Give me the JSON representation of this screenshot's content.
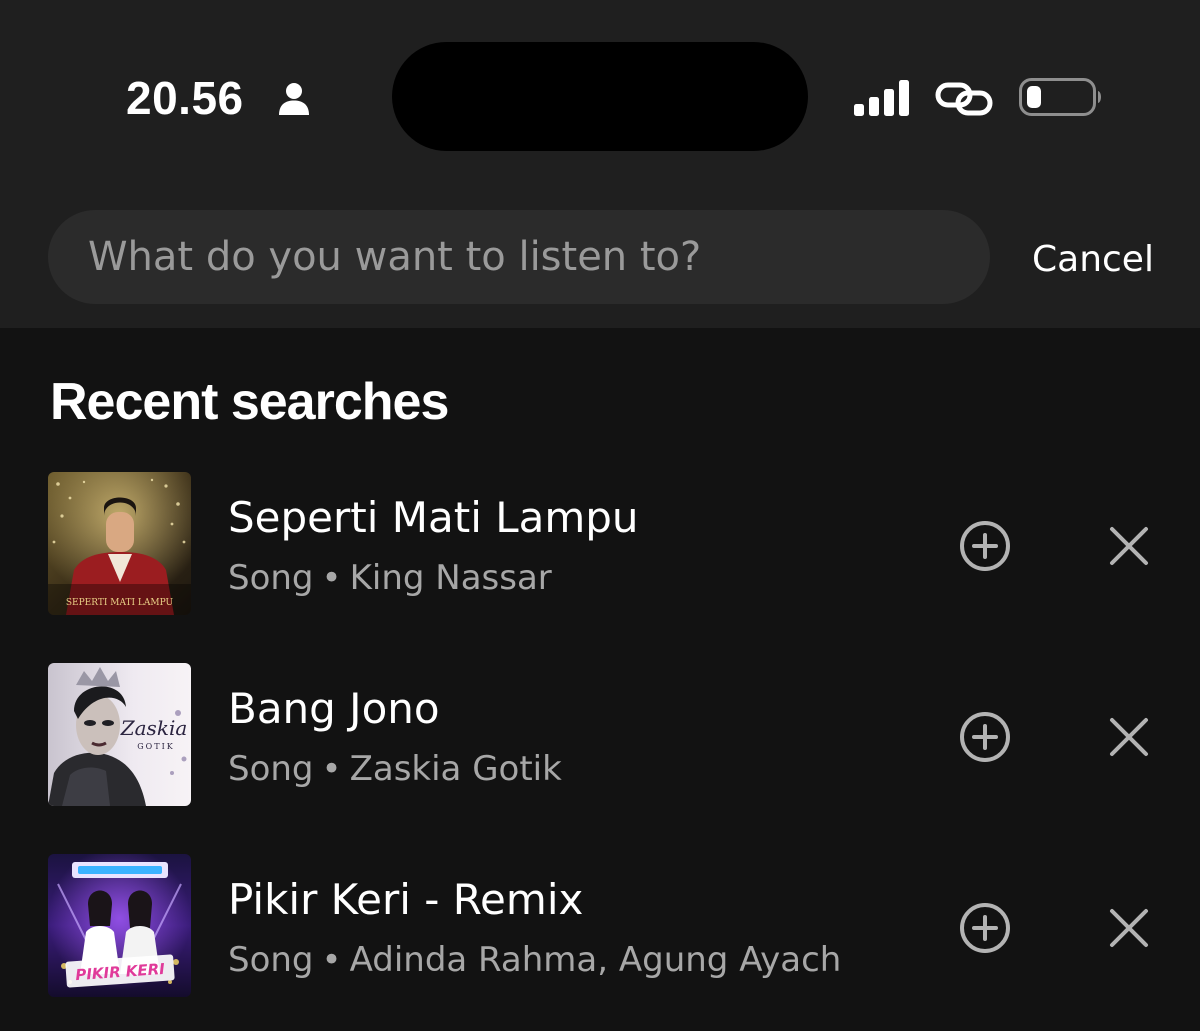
{
  "status_bar": {
    "time": "20.56",
    "icons": [
      "person-icon",
      "signal-icon",
      "link-icon",
      "battery-icon"
    ]
  },
  "search": {
    "placeholder": "What do you want to listen to?",
    "value": "",
    "cancel_label": "Cancel"
  },
  "recent": {
    "title": "Recent searches",
    "items": [
      {
        "title": "Seperti Mati Lampu",
        "type": "Song",
        "separator": "•",
        "artist": "King Nassar",
        "art_text": "SEPERTI MATI LAMPU",
        "add_icon": "plus-circle-icon",
        "remove_icon": "close-icon"
      },
      {
        "title": "Bang Jono",
        "type": "Song",
        "separator": "•",
        "artist": "Zaskia Gotik",
        "art_text": "Zaskia",
        "art_subtext": "GOTIK",
        "add_icon": "plus-circle-icon",
        "remove_icon": "close-icon"
      },
      {
        "title": "Pikir Keri - Remix",
        "type": "Song",
        "separator": "•",
        "artist": "Adinda Rahma, Agung Ayach",
        "art_text": "PIKIR KERI",
        "add_icon": "plus-circle-icon",
        "remove_icon": "close-icon"
      }
    ]
  },
  "colors": {
    "background": "#121212",
    "header_background": "#1f1f1f",
    "search_background": "#2b2b2b",
    "primary_text": "#ffffff",
    "secondary_text": "#a7a7a7",
    "placeholder_text": "#9a9a9a"
  }
}
